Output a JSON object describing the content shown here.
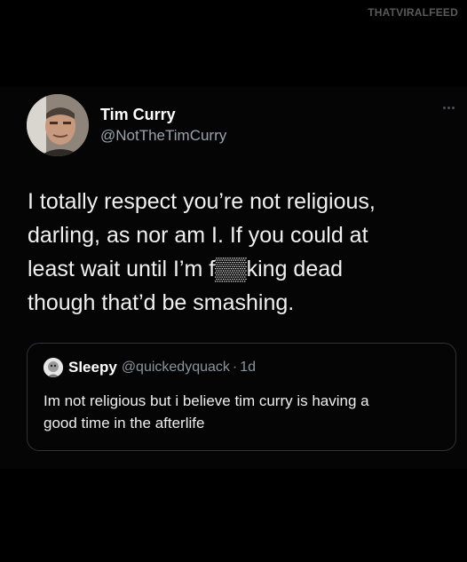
{
  "watermark": "THATVIRALFEED",
  "tweet": {
    "author": {
      "name": "Tim Curry",
      "handle": "@NotTheTimCurry",
      "avatar_icon": "profile-photo"
    },
    "more_icon": "more-dots-icon",
    "text": "I totally respect you’re not religious,\ndarling, as nor am I. If you could at\nleast wait until I’m f▒▒king dead\nthough that’d be smashing."
  },
  "quoted_tweet": {
    "author": {
      "name": "Sleepy",
      "handle": "@quickedyquack",
      "avatar_icon": "profile-photo"
    },
    "separator": "·",
    "time": "1d",
    "text": "Im not religious but i believe tim curry is having a\ngood time in the afterlife"
  },
  "colors": {
    "background": "#000000",
    "text_primary": "#e7e9ea",
    "text_secondary": "#9aa3ab",
    "border": "#2f3336"
  }
}
